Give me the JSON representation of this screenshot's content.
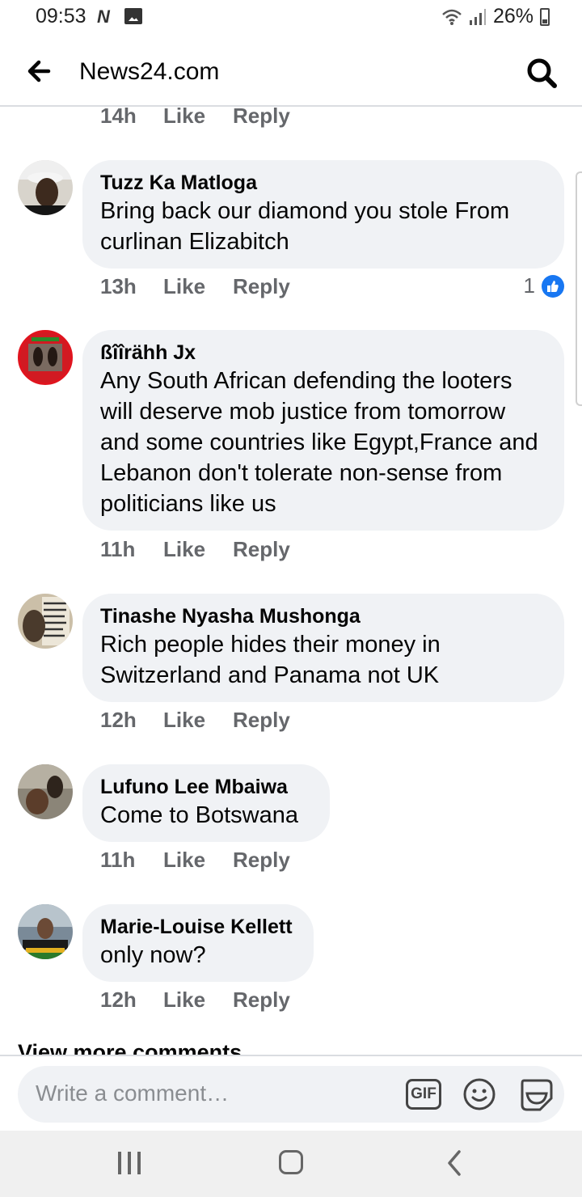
{
  "status_bar": {
    "time": "09:53",
    "notification_letter": "N",
    "battery": "26%"
  },
  "header": {
    "title": "News24.com"
  },
  "comments": [
    {
      "author": "",
      "text": "",
      "time": "14h",
      "like": "Like",
      "reply": "Reply"
    },
    {
      "author": "Tuzz Ka Matloga",
      "text": "Bring back our diamond you stole From curlinan Elizabitch",
      "time": "13h",
      "like": "Like",
      "reply": "Reply",
      "reaction_count": "1"
    },
    {
      "author": "ßîîrähh Jx",
      "text": "Any South African defending the looters will deserve mob justice from tomorrow and some countries like Egypt,France and Lebanon don't tolerate non-sense from politicians like us",
      "time": "11h",
      "like": "Like",
      "reply": "Reply"
    },
    {
      "author": "Tinashe Nyasha Mushonga",
      "text": "Rich people hides their money in Switzerland and Panama not UK",
      "time": "12h",
      "like": "Like",
      "reply": "Reply"
    },
    {
      "author": "Lufuno Lee Mbaiwa",
      "text": "Come to Botswana",
      "time": "11h",
      "like": "Like",
      "reply": "Reply"
    },
    {
      "author": "Marie-Louise Kellett",
      "text": "only now?",
      "time": "12h",
      "like": "Like",
      "reply": "Reply"
    }
  ],
  "view_more": "View more comments",
  "composer": {
    "placeholder": "Write a comment…",
    "gif_label": "GIF"
  },
  "icons": {
    "back": "arrow-left-icon",
    "search": "search-icon",
    "like_reaction": "thumbs-up-icon",
    "emoji": "smiley-icon",
    "sticker": "sticker-icon",
    "nav_recent": "recent-apps-icon",
    "nav_home": "home-icon",
    "nav_back": "back-chevron-icon"
  },
  "colors": {
    "accent": "#1877f2",
    "bubble": "#f0f2f5",
    "meta": "#65676b"
  }
}
